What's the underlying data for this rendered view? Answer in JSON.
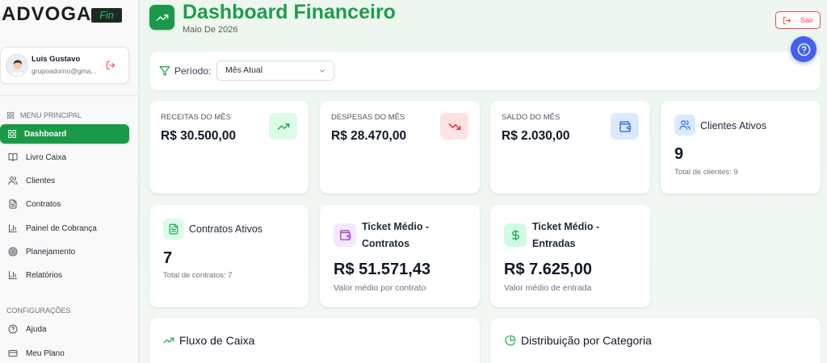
{
  "theme": {
    "primary": "#1a9a48",
    "title_green": "#1f9d4c",
    "danger": "#ef4444",
    "help_blue": "#4361ee"
  },
  "brand": {
    "logo_text": "ADVOGA",
    "logo_badge": "Fin"
  },
  "user": {
    "name": "Luis Gustavo",
    "email": "grupoadorno@gma...",
    "avatar_icon": "user-avatar",
    "logout_icon": "log-out-icon"
  },
  "sidebar": {
    "main_menu": {
      "title": "MENU PRINCIPAL",
      "icon": "layout-grid-icon",
      "items": [
        {
          "label": "Dashboard",
          "icon": "layout-grid-icon",
          "active": true
        },
        {
          "label": "Livro Caixa",
          "icon": "book-open-icon",
          "active": false
        },
        {
          "label": "Clientes",
          "icon": "users-icon",
          "active": false
        },
        {
          "label": "Contratos",
          "icon": "file-text-icon",
          "active": false
        },
        {
          "label": "Painel de Cobrança",
          "icon": "bar-chart-icon",
          "active": false
        },
        {
          "label": "Planejamento",
          "icon": "target-icon",
          "active": false
        },
        {
          "label": "Relatórios",
          "icon": "bar-chart-icon",
          "active": false
        }
      ]
    },
    "settings": {
      "title": "CONFIGURAÇÕES",
      "items": [
        {
          "label": "Ajuda",
          "icon": "help-circle-icon"
        },
        {
          "label": "Meu Plano",
          "icon": "credit-card-icon"
        }
      ]
    }
  },
  "header": {
    "icon": "trending-up-icon",
    "title": "Dashboard Financeiro",
    "subtitle": "Maio De 2026",
    "logout_label": "Sair",
    "help_icon": "help-circle-icon"
  },
  "filter": {
    "icon": "filter-icon",
    "label": "Período:",
    "selected": "Mês Atual"
  },
  "summary_cards": [
    {
      "label": "RECEITAS DO MÊS",
      "value": "R$ 30.500,00",
      "icon": "trending-up-icon",
      "accent": "#16a34a",
      "icon_bg": "#dcfce7"
    },
    {
      "label": "DESPESAS DO MÊS",
      "value": "R$ 28.470,00",
      "icon": "trending-down-icon",
      "accent": "#dc2626",
      "icon_bg": "#fee2e2"
    },
    {
      "label": "SALDO DO MÊS",
      "value": "R$ 2.030,00",
      "icon": "wallet-icon",
      "accent": "#2563eb",
      "icon_bg": "#dbeafe"
    }
  ],
  "stat_cards": [
    {
      "title": "Clientes Ativos",
      "value": "9",
      "subtitle": "Total de clientes: 9",
      "icon": "users-icon",
      "accent": "#2563eb",
      "icon_bg": "#dbeafe"
    },
    {
      "title": "Contratos Ativos",
      "value": "7",
      "subtitle": "Total de contratos: 7",
      "icon": "file-text-icon",
      "accent": "#16a34a",
      "icon_bg": "#dcfce7"
    },
    {
      "title": "Ticket Médio - Contratos",
      "value": "R$ 51.571,43",
      "subtitle": "Valor médio por contrato",
      "icon": "wallet-icon",
      "accent": "#9333ea",
      "icon_bg": "#f3e8ff"
    },
    {
      "title": "Ticket Médio - Entradas",
      "value": "R$ 7.625,00",
      "subtitle": "Valor médio de entrada",
      "icon": "dollar-sign-icon",
      "accent": "#16a34a",
      "icon_bg": "#d1fae5"
    }
  ],
  "panels": [
    {
      "title": "Fluxo de Caixa",
      "icon": "trending-up-icon",
      "accent": "#16a34a"
    },
    {
      "title": "Distribuição por Categoria",
      "icon": "pie-chart-icon",
      "accent": "#16a34a"
    }
  ]
}
